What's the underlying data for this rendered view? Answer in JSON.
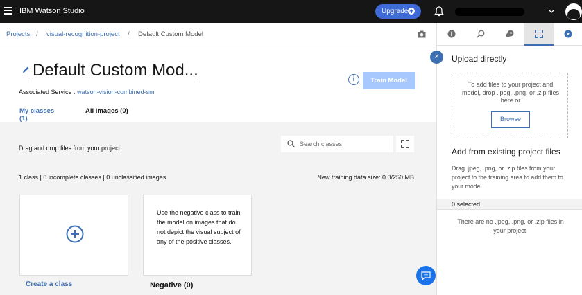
{
  "app": {
    "brand": "IBM Watson Studio",
    "upgrade_label": "Upgrade"
  },
  "breadcrumb": {
    "items": [
      "Projects",
      "visual-recognition-project",
      "Default Custom Model"
    ],
    "separator": "/"
  },
  "header": {
    "title": "Default Custom Mod...",
    "service_label": "Associated Service :",
    "service_name": "watson-vision-combined-sm",
    "info_glyph": "i",
    "train_label": "Train Model",
    "tabs": [
      {
        "label": "My classes (1)",
        "active": true
      },
      {
        "label": "All images (0)",
        "active": false
      }
    ]
  },
  "main": {
    "drag_text": "Drag and drop files from your project.",
    "search_placeholder": "Search classes",
    "stats": "1 class | 0 incomplete classes | 0 unclassified images",
    "training_size": "New training data size: 0.0/250 MB",
    "create_label": "Create a class",
    "negative_desc": "Use the negative class to train the model on images that do not depict the visual subject of any of the positive classes.",
    "negative_label": "Negative (0)"
  },
  "panel": {
    "close_glyph": "×",
    "upload_title": "Upload directly",
    "dropzone_text": "To add files to your project and model, drop .jpeg, .png, or .zip files here or",
    "browse_label": "Browse",
    "existing_title": "Add from existing project files",
    "existing_desc": "Drag .jpeg, .png, or .zip files from your project to the training area to add them to your model.",
    "selected": "0 selected",
    "empty_text": "There are no .jpeg, .png, or .zip files in your project.",
    "tabs": [
      "info-icon",
      "search-image-icon",
      "palette-icon",
      "assets-grid-icon",
      "compass-icon"
    ],
    "active_tab": "assets-grid-icon"
  },
  "colors": {
    "accent": "#3d70b2",
    "topbar": "#161616",
    "upgrade": "#3e6bd8",
    "train_disabled": "#a6c8ff",
    "chat": "#1a73e8"
  }
}
